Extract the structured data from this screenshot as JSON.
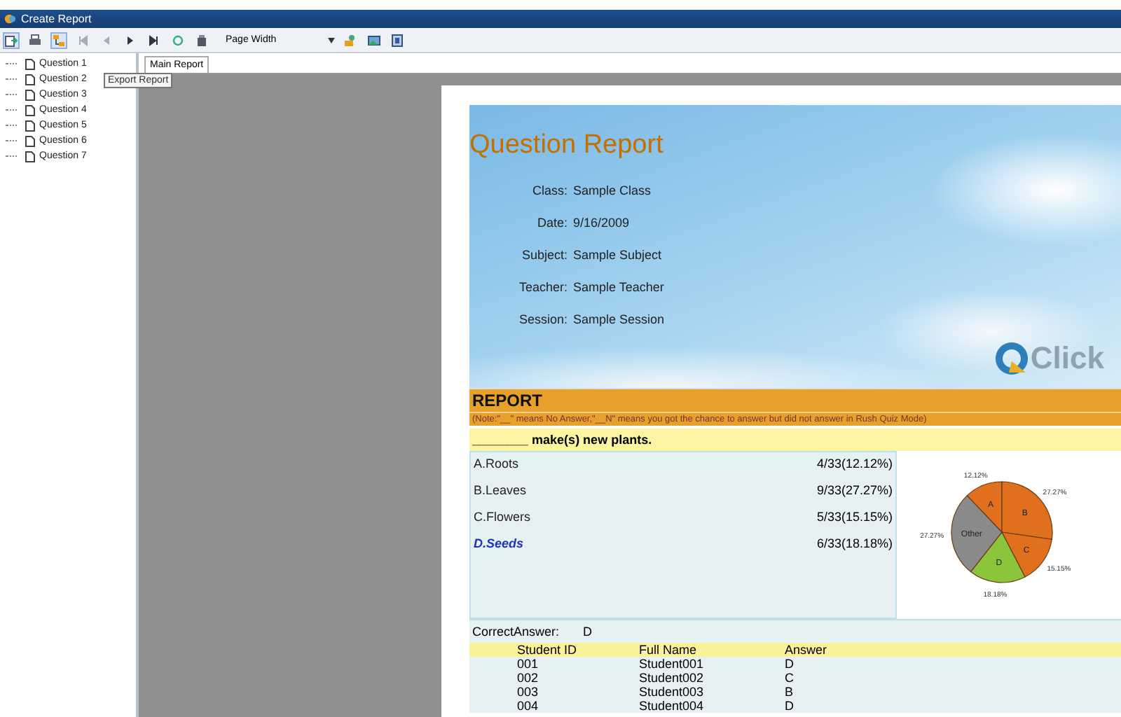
{
  "window": {
    "title": "Create Report"
  },
  "toolbar": {
    "zoom": "Page Width"
  },
  "tooltip": "Export Report",
  "tree": {
    "items": [
      {
        "label": "Question 1"
      },
      {
        "label": "Question 2"
      },
      {
        "label": "Question 3"
      },
      {
        "label": "Question 4"
      },
      {
        "label": "Question 5"
      },
      {
        "label": "Question 6"
      },
      {
        "label": "Question 7"
      }
    ]
  },
  "tabs": [
    {
      "label": "Main Report",
      "selected": true
    }
  ],
  "report": {
    "title": "Question Report",
    "fields": [
      {
        "label": "Class:",
        "value": "Sample Class"
      },
      {
        "label": "Date:",
        "value": "9/16/2009"
      },
      {
        "label": "Subject:",
        "value": "Sample Subject"
      },
      {
        "label": "Teacher:",
        "value": "Sample Teacher"
      },
      {
        "label": "Session:",
        "value": "Sample Session"
      }
    ],
    "logo": "Click",
    "section": "REPORT",
    "note": "(Note:\"__\" means No Answer,\"__N\" means you got the chance to answer but did not answer in Rush Quiz Mode)",
    "question": "________ make(s) new plants.",
    "options": [
      {
        "label": "A.Roots",
        "result": "4/33(12.12%)",
        "correct": false
      },
      {
        "label": "B.Leaves",
        "result": "9/33(27.27%)",
        "correct": false
      },
      {
        "label": "C.Flowers",
        "result": "5/33(15.15%)",
        "correct": false
      },
      {
        "label": "D.Seeds",
        "result": "6/33(18.18%)",
        "correct": true
      }
    ],
    "chart_data": {
      "type": "pie",
      "categories": [
        "A",
        "B",
        "C",
        "D",
        "Other"
      ],
      "series": [
        {
          "values": [
            12.12,
            27.27,
            15.15,
            18.18,
            27.27
          ]
        }
      ],
      "colors": [
        "#e0701e",
        "#e0701e",
        "#e0701e",
        "#8cc43c",
        "#8a8a8a"
      ],
      "value_labels": [
        "12.12%",
        "27.27%",
        "15.15%",
        "18.18%",
        "27.27%"
      ]
    },
    "correct_answer": {
      "label": "CorrectAnswer:",
      "value": "D"
    },
    "table": {
      "columns": [
        "Student ID",
        "Full Name",
        "Answer"
      ],
      "rows": [
        [
          "001",
          "Student001",
          "D"
        ],
        [
          "002",
          "Student002",
          "C"
        ],
        [
          "003",
          "Student003",
          "B"
        ],
        [
          "004",
          "Student004",
          "D"
        ]
      ]
    }
  }
}
